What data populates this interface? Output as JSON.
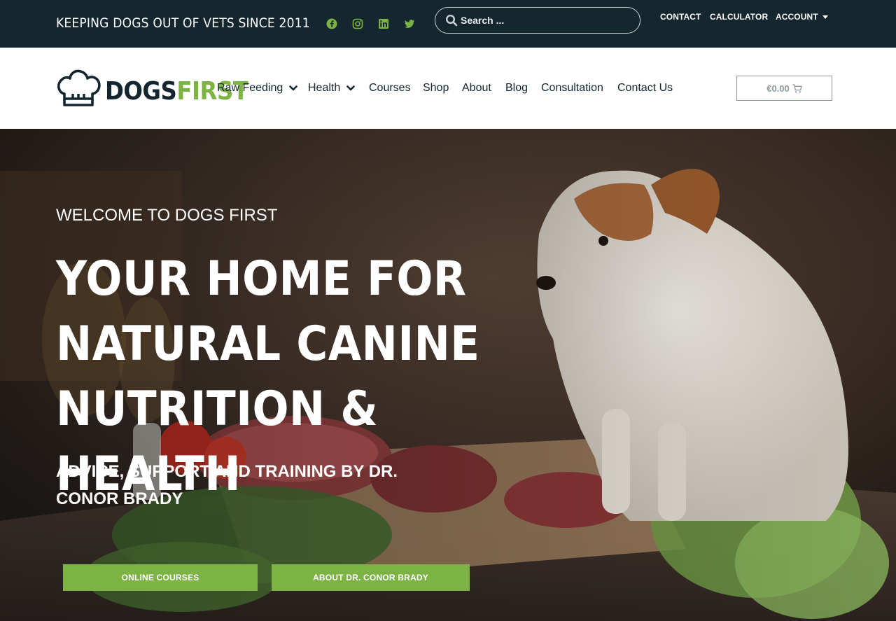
{
  "topbar": {
    "tagline": "KEEPING DOGS OUT OF VETS SINCE 2011",
    "social": [
      {
        "icon": "facebook-icon"
      },
      {
        "icon": "instagram-icon"
      },
      {
        "icon": "linkedin-icon"
      },
      {
        "icon": "twitter-icon"
      }
    ],
    "search": {
      "placeholder": "Search ..."
    },
    "links": {
      "contact": "CONTACT",
      "calculator": "CALCULATOR",
      "account": "ACCOUNT"
    }
  },
  "header": {
    "logo": {
      "dogs": "DOGS",
      "first": "FIRST"
    },
    "nav": {
      "raw_feeding": "Raw Feeding",
      "health": "Health",
      "courses": "Courses",
      "shop": "Shop",
      "about": "About",
      "blog": "Blog",
      "consultation": "Consultation",
      "contact_us": "Contact Us"
    },
    "cart": {
      "amount": "€0.00",
      "icon": "cart-icon"
    }
  },
  "hero": {
    "welcome": "WELCOME TO DOGS FIRST",
    "headline": "YOUR HOME FOR NATURAL CANINE NUTRITION & HEALTH",
    "subheadline": "ADVICE, SUPPORT AND TRAINING BY DR. CONOR BRADY",
    "buttons": {
      "courses": "ONLINE COURSES",
      "about": "ABOUT DR. CONOR BRADY"
    }
  },
  "colors": {
    "topbar": "#14262e",
    "brand_dark": "#13262f",
    "brand_green": "#7cb342",
    "social_green": "#7cb342"
  }
}
